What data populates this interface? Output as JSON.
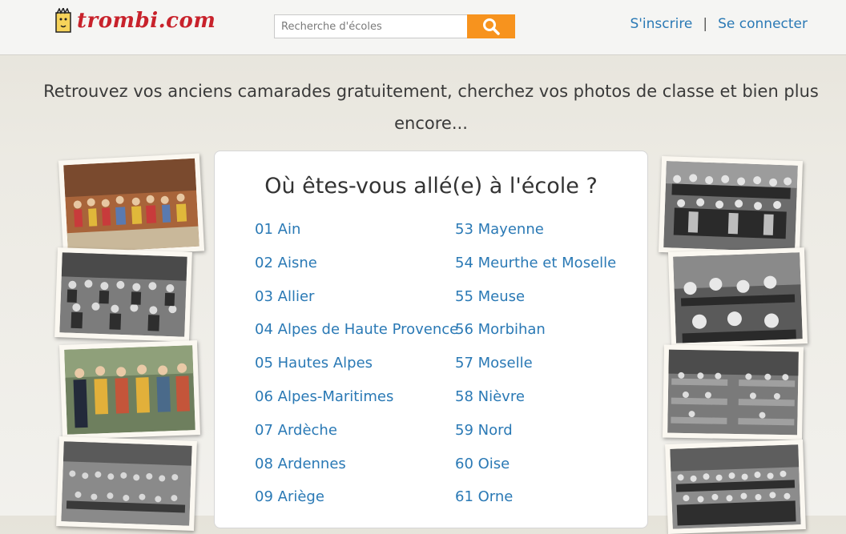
{
  "header": {
    "logo_text": "trombi.com",
    "search_placeholder": "Recherche d'écoles",
    "search_icon": "search-icon",
    "signup_label": "S'inscrire",
    "separator": "|",
    "login_label": "Se connecter"
  },
  "tagline": "Retrouvez vos anciens camarades gratuitement, cherchez vos photos de classe et bien plus encore...",
  "card": {
    "title": "Où êtes-vous allé(e) à l'école ?",
    "left": [
      "01 Ain",
      "02 Aisne",
      "03 Allier",
      "04 Alpes de Haute Provence",
      "05 Hautes Alpes",
      "06 Alpes-Maritimes",
      "07 Ardèche",
      "08 Ardennes",
      "09 Ariège"
    ],
    "right": [
      "53 Mayenne",
      "54 Meurthe et Moselle",
      "55 Meuse",
      "56 Morbihan",
      "57 Moselle",
      "58 Nièvre",
      "59 Nord",
      "60 Oise",
      "61 Orne"
    ]
  },
  "colors": {
    "brand_red": "#c8222b",
    "link_blue": "#2a79b5",
    "search_orange": "#f7931e"
  }
}
